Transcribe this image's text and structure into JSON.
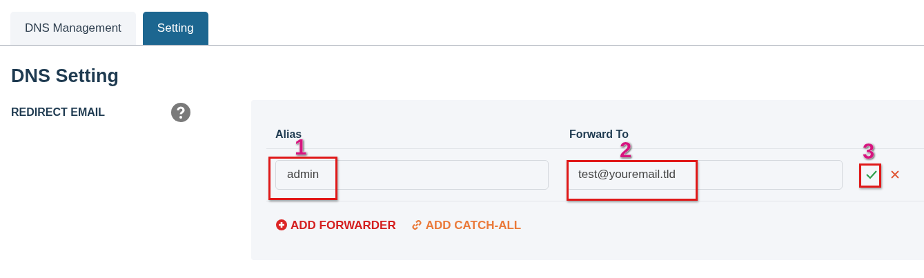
{
  "tabs": [
    {
      "label": "DNS Management",
      "selected": false
    },
    {
      "label": "Setting",
      "selected": true
    }
  ],
  "heading": "DNS Setting",
  "section": {
    "label": "REDIRECT EMAIL"
  },
  "table": {
    "columns": [
      "Alias",
      "Forward To"
    ],
    "rows": [
      {
        "alias": "admin",
        "forward_to": "test@youremail.tld"
      }
    ]
  },
  "actions": [
    {
      "kind": "add",
      "label": "ADD FORWARDER"
    },
    {
      "kind": "link",
      "label": "ADD CATCH-ALL"
    }
  ],
  "annotations": [
    {
      "label": "1"
    },
    {
      "label": "2"
    },
    {
      "label": "3"
    }
  ]
}
